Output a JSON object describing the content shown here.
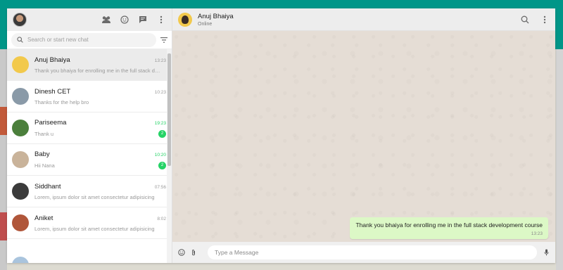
{
  "sidebar": {
    "search_placeholder": "Search or start new chat",
    "chats": [
      {
        "name": "Anuj Bhaiya",
        "time": "13:23",
        "preview": "Thank you bhaiya for enrolling me in the full stack development course",
        "unread": "",
        "active": true,
        "avatar_color": "#f2c94c"
      },
      {
        "name": "Dinesh CET",
        "time": "10:23",
        "preview": "Thanks for the help bro",
        "unread": "",
        "active": false,
        "avatar_color": "#8a9aa8"
      },
      {
        "name": "Pariseema",
        "time": "19:23",
        "preview": "Thank u",
        "unread": "2",
        "active": false,
        "avatar_color": "#4b7f3c"
      },
      {
        "name": "Baby",
        "time": "10:20",
        "preview": "Hii Nana",
        "unread": "2",
        "active": false,
        "avatar_color": "#c9b39a"
      },
      {
        "name": "Siddhant",
        "time": "07:56",
        "preview": "Lorem, ipsum dolor sit amet consectetur adipisicing",
        "unread": "",
        "active": false,
        "avatar_color": "#3b3b3b"
      },
      {
        "name": "Aniket",
        "time": "8:02",
        "preview": "Lorem, ipsum dolor sit amet consectetur adipisicing",
        "unread": "",
        "active": false,
        "avatar_color": "#b0563a"
      }
    ]
  },
  "conversation": {
    "name": "Anuj Bhaiya",
    "status": "Online",
    "message": {
      "text": "Thank you bhaiya for enrolling me in the full stack development course",
      "time": "13:23"
    },
    "composer_placeholder": "Type a Message"
  },
  "colors": {
    "accent": "#009688",
    "unread": "#25d366",
    "outgoing_bubble": "#dcf8c6",
    "chat_background": "#e5ddd5"
  },
  "icons": [
    "community-icon",
    "status-icon",
    "new-chat-icon",
    "menu-dots-icon",
    "search-icon",
    "filter-icon",
    "emoji-icon",
    "attach-icon",
    "mic-icon"
  ]
}
